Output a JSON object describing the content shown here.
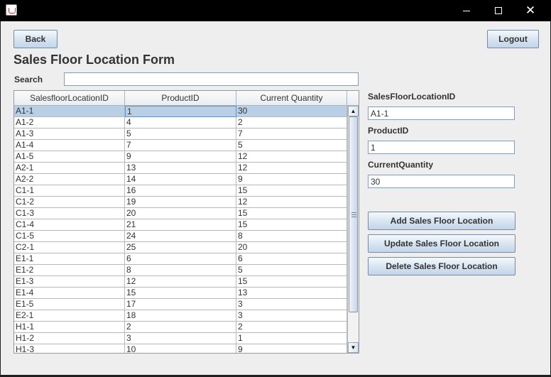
{
  "window": {
    "app_icon": "java-icon",
    "controls": {
      "minimize": "minimize-icon",
      "maximize": "maximize-icon",
      "close": "✕"
    }
  },
  "toolbar": {
    "back_label": "Back",
    "logout_label": "Logout"
  },
  "form": {
    "title": "Sales Floor Location Form"
  },
  "search": {
    "label": "Search",
    "value": ""
  },
  "table": {
    "headers": [
      "SalesfloorLocationID",
      "ProductID",
      "Current Quantity"
    ],
    "selected_row": 0,
    "rows": [
      [
        "A1-1",
        "1",
        "30"
      ],
      [
        "A1-2",
        "4",
        "2"
      ],
      [
        "A1-3",
        "5",
        "7"
      ],
      [
        "A1-4",
        "7",
        "5"
      ],
      [
        "A1-5",
        "9",
        "12"
      ],
      [
        "A2-1",
        "13",
        "12"
      ],
      [
        "A2-2",
        "14",
        "9"
      ],
      [
        "C1-1",
        "16",
        "15"
      ],
      [
        "C1-2",
        "19",
        "12"
      ],
      [
        "C1-3",
        "20",
        "15"
      ],
      [
        "C1-4",
        "21",
        "15"
      ],
      [
        "C1-5",
        "24",
        "8"
      ],
      [
        "C2-1",
        "25",
        "20"
      ],
      [
        "E1-1",
        "6",
        "6"
      ],
      [
        "E1-2",
        "8",
        "5"
      ],
      [
        "E1-3",
        "12",
        "15"
      ],
      [
        "E1-4",
        "15",
        "13"
      ],
      [
        "E1-5",
        "17",
        "3"
      ],
      [
        "E2-1",
        "18",
        "3"
      ],
      [
        "H1-1",
        "2",
        "2"
      ],
      [
        "H1-2",
        "3",
        "1"
      ],
      [
        "H1-3",
        "10",
        "9"
      ]
    ]
  },
  "details": {
    "location_label": "SalesFloorLocationID",
    "location_value": "A1-1",
    "product_label": "ProductID",
    "product_value": "1",
    "quantity_label": "CurrentQuantity",
    "quantity_value": "30"
  },
  "actions": {
    "add_label": "Add Sales Floor Location",
    "update_label": "Update Sales Floor Location",
    "delete_label": "Delete Sales Floor Location"
  },
  "colors": {
    "titlebar": "#000000",
    "background": "#eeeeee",
    "selection": "#b8cfe5",
    "button_top": "#f5f9fd",
    "button_bottom": "#c2d5ea"
  }
}
